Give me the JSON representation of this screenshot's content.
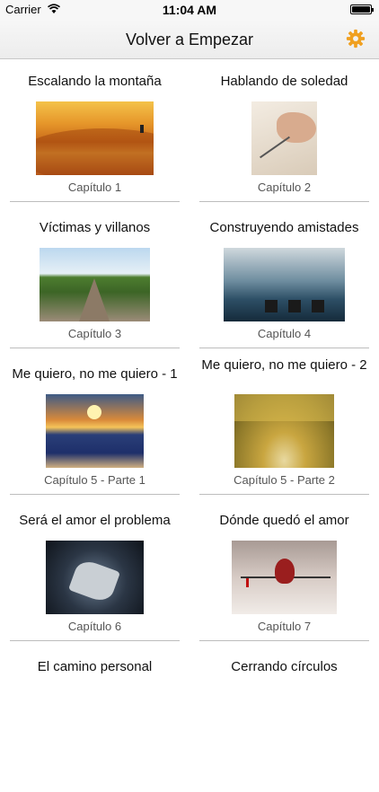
{
  "status": {
    "carrier": "Carrier",
    "time": "11:04 AM"
  },
  "nav": {
    "title": "Volver a Empezar",
    "settings_icon": "gear-icon",
    "accent": "#f0a020"
  },
  "chapters": [
    {
      "title": "Escalando la montaña",
      "caption": "Capítulo 1"
    },
    {
      "title": "Hablando de soledad",
      "caption": "Capítulo 2"
    },
    {
      "title": "Víctimas y villanos",
      "caption": "Capítulo 3"
    },
    {
      "title": "Construyendo amistades",
      "caption": "Capítulo 4"
    },
    {
      "title": "Me quiero, no me quiero - 1",
      "caption": "Capítulo 5 - Parte 1"
    },
    {
      "title": "Me quiero, no me quiero - 2",
      "caption": "Capítulo 5 - Parte 2"
    },
    {
      "title": "Será el amor el problema",
      "caption": "Capítulo 6"
    },
    {
      "title": "Dónde quedó el amor",
      "caption": "Capítulo 7"
    },
    {
      "title": "El camino personal",
      "caption": ""
    },
    {
      "title": "Cerrando círculos",
      "caption": ""
    }
  ]
}
